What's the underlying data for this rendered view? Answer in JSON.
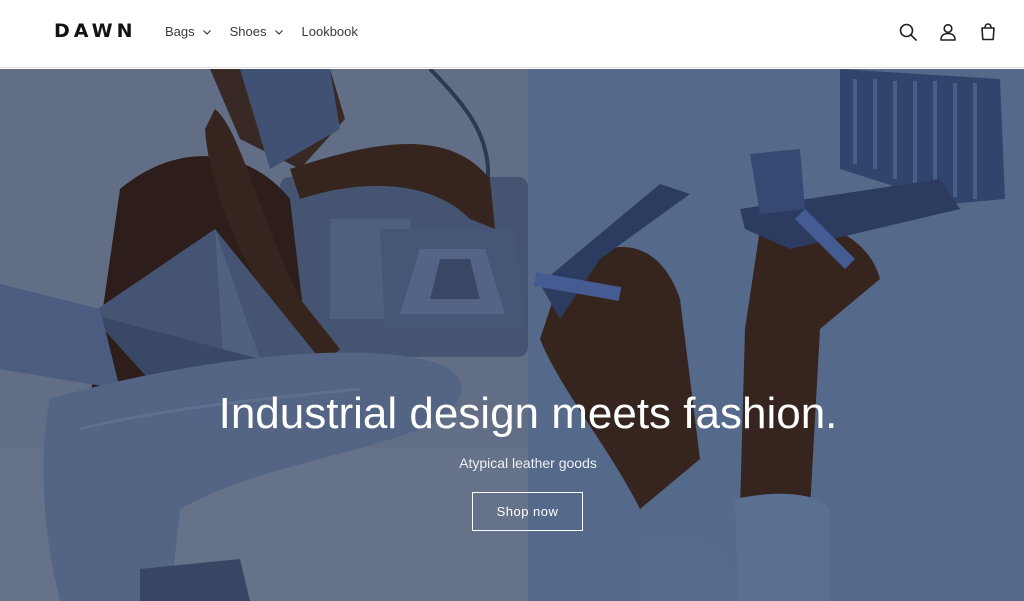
{
  "brand": {
    "logo": "DAWN"
  },
  "nav": {
    "items": [
      {
        "label": "Bags",
        "has_dropdown": true
      },
      {
        "label": "Shoes",
        "has_dropdown": true
      },
      {
        "label": "Lookbook",
        "has_dropdown": false
      }
    ]
  },
  "header_icons": [
    "search-icon",
    "account-icon",
    "cart-icon"
  ],
  "hero": {
    "title": "Industrial design meets fashion.",
    "subtitle": "Atypical leather goods",
    "button_label": "Shop now"
  },
  "colors": {
    "header_bg": "#ffffff",
    "hero_left_bg": "#6a7891",
    "hero_right_bg": "#5d7396",
    "denim": "#4a5a78",
    "leather_blue": "#3f5788",
    "skin": "#3a241c",
    "hero_text": "#ffffff"
  }
}
